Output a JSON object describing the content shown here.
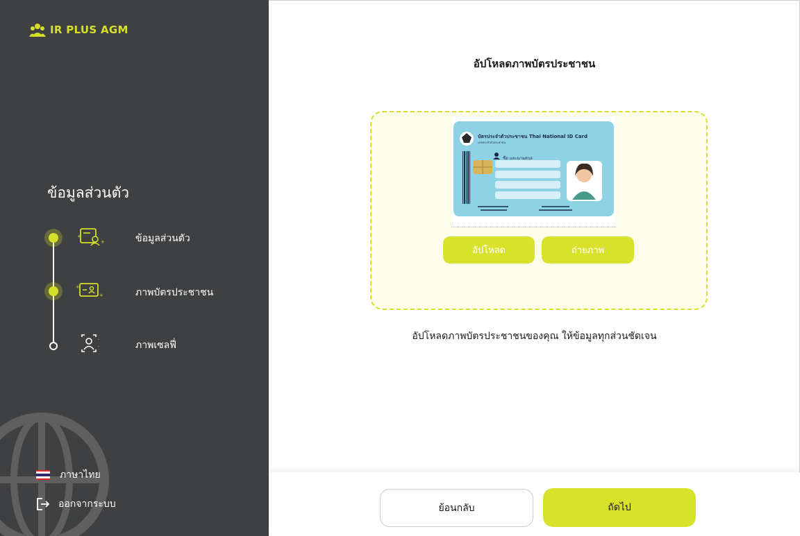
{
  "brand": {
    "name": "IR PLUS AGM",
    "accent": "#d6e02a",
    "sidebar_bg": "#3f4041"
  },
  "sidebar": {
    "title": "ข้อมูลส่วนตัว",
    "steps": [
      {
        "label": "ข้อมูลส่วนตัว",
        "state": "done",
        "icon": "profile-form-icon"
      },
      {
        "label": "ภาพบัตรประชาชน",
        "state": "active",
        "icon": "id-card-icon"
      },
      {
        "label": "ภาพเซลฟี่",
        "state": "pending",
        "icon": "selfie-scan-icon"
      }
    ],
    "language": "ภาษาไทย",
    "logout": "ออกจากระบบ"
  },
  "main": {
    "title": "อัปโหลดภาพบัตรประชาชน",
    "card_preview": {
      "heading": "บัตรประจำตัวประชาชน Thai National ID Card",
      "subheading": "เลขประจำตัวประชาชน",
      "name_label": "ชื่อ และนามสกุล"
    },
    "upload_label": "อัปโหลด",
    "camera_label": "ถ่ายภาพ",
    "hint": "อัปโหลดภาพบัตรประชาชนของคุณ ให้ข้อมูลทุกส่วนชัดเจน"
  },
  "footer": {
    "back_label": "ย้อนกลับ",
    "next_label": "ถัดไป"
  }
}
